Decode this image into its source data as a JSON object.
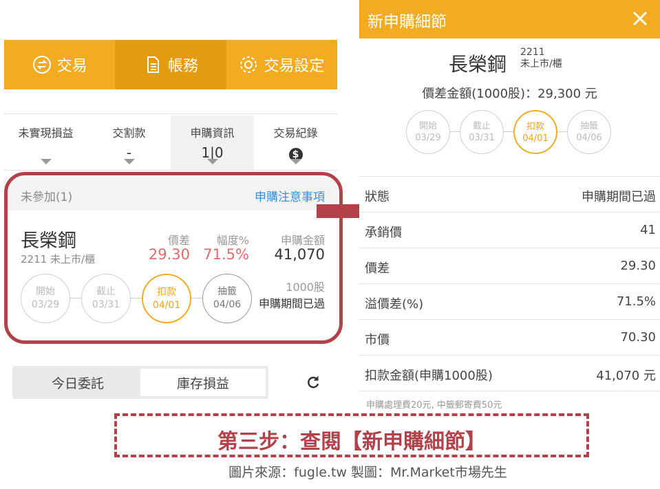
{
  "left": {
    "tabs": [
      {
        "label": "交易",
        "icon": "swap-icon"
      },
      {
        "label": "帳務",
        "icon": "document-icon"
      },
      {
        "label": "交易設定",
        "icon": "gear-icon"
      }
    ],
    "info": [
      {
        "title": "未實現損益",
        "value": ""
      },
      {
        "title": "交割款",
        "value": "-"
      },
      {
        "title": "申購資訊",
        "value": "1|0"
      },
      {
        "title": "交易紀錄",
        "value": "$"
      }
    ],
    "section_label": "未參加(1)",
    "section_link": "申購注意事項",
    "stock": {
      "name": "長榮鋼",
      "sub": "2211 未上市/櫃",
      "metrics": [
        {
          "label": "價差",
          "value": "29.30"
        },
        {
          "label": "幅度%",
          "value": "71.5%"
        },
        {
          "label": "申購金額",
          "value": "41,070"
        }
      ],
      "steps": [
        {
          "label": "開始",
          "date": "03/29"
        },
        {
          "label": "截止",
          "date": "03/31"
        },
        {
          "label": "扣款",
          "date": "04/01"
        },
        {
          "label": "抽籤",
          "date": "04/06"
        }
      ],
      "shares": "1000股",
      "status": "申購期間已過"
    },
    "bottom_tabs": [
      "今日委託",
      "庫存損益"
    ]
  },
  "right": {
    "title": "新申購細節",
    "stock_name": "長榮鋼",
    "code": "2211",
    "market": "未上市/櫃",
    "spread_line": "價差金額(1000股)：29,300 元",
    "steps": [
      {
        "label": "開始",
        "date": "03/29"
      },
      {
        "label": "截止",
        "date": "03/31"
      },
      {
        "label": "扣款",
        "date": "04/01"
      },
      {
        "label": "抽籤",
        "date": "04/06"
      }
    ],
    "rows": [
      {
        "key": "狀態",
        "value": "申購期間已過"
      },
      {
        "key": "承銷價",
        "value": "41"
      },
      {
        "key": "價差",
        "value": "29.30"
      },
      {
        "key": "溢價差(%)",
        "value": "71.5%"
      },
      {
        "key": "市價",
        "value": "70.30"
      },
      {
        "key": "扣款金額(申購1000股)",
        "value": "41,070 元"
      }
    ],
    "note": "申購處理費20元, 中籤郵寄費50元"
  },
  "caption": "第三步：查閱【新申購細節】",
  "source": "圖片來源：fugle.tw  製圖：Mr.Market市場先生",
  "colors": {
    "accent": "#f3ac21",
    "accent_dark": "#e39b10",
    "highlight": "#b2414a",
    "red_value": "#e46a6a",
    "link": "#3a8fd8"
  }
}
